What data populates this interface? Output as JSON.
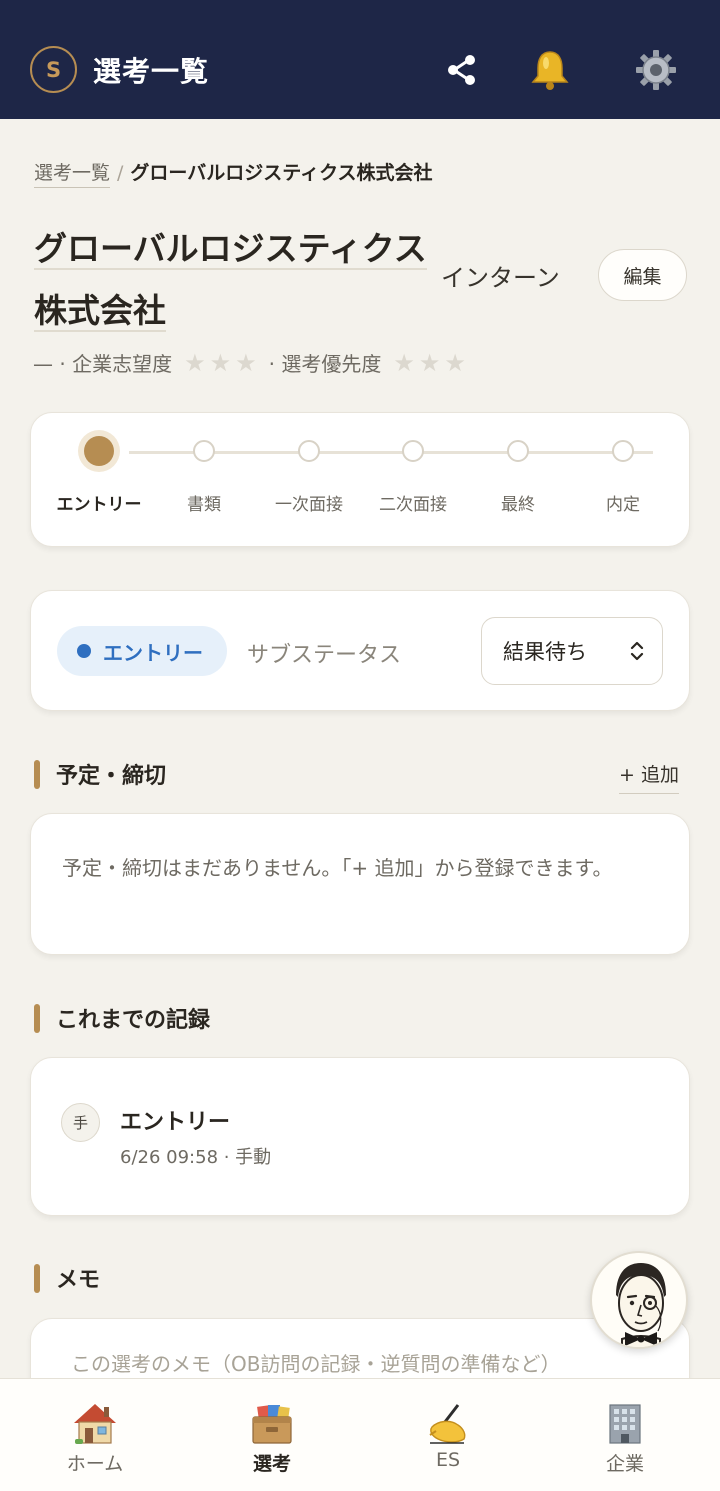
{
  "header": {
    "logo_letter": "S",
    "title": "選考一覧"
  },
  "breadcrumb": {
    "parent": "選考一覧",
    "separator": "/",
    "current": "グローバルロジスティクス株式会社"
  },
  "company": {
    "name": "グローバルロジスティクス株式会社",
    "job_type": "インターン",
    "edit_label": "編集"
  },
  "meta": {
    "prefix": "— · 企業志望度",
    "aspiration_stars": "★★★",
    "aspiration_rating": 0,
    "priority_label": "· 選考優先度",
    "priority_stars": "★★★",
    "priority_rating": 0
  },
  "stages": [
    {
      "label": "エントリー",
      "active": true
    },
    {
      "label": "書類",
      "active": false
    },
    {
      "label": "一次面接",
      "active": false
    },
    {
      "label": "二次面接",
      "active": false
    },
    {
      "label": "最終",
      "active": false
    },
    {
      "label": "内定",
      "active": false
    }
  ],
  "status": {
    "current": "エントリー",
    "substatus_label": "サブステータス",
    "substatus_value": "結果待ち"
  },
  "schedule": {
    "title": "予定・締切",
    "add_label": "+ 追加",
    "empty_text": "予定・締切はまだありません。「+ 追加」から登録できます。"
  },
  "history": {
    "title": "これまでの記録",
    "records": [
      {
        "icon_char": "手",
        "title": "エントリー",
        "sub": "6/26 09:58 · 手動"
      }
    ]
  },
  "memo": {
    "title": "メモ",
    "placeholder": "この選考のメモ（OB訪問の記録・逆質問の準備など）"
  },
  "tabs": [
    {
      "label": "ホーム",
      "icon": "house-icon",
      "active": false
    },
    {
      "label": "選考",
      "icon": "card-box-icon",
      "active": true
    },
    {
      "label": "ES",
      "icon": "writing-hand-icon",
      "active": false
    },
    {
      "label": "企業",
      "icon": "office-building-icon",
      "active": false
    }
  ],
  "colors": {
    "header_bg": "#1e2647",
    "accent": "#b68d52",
    "status_blue": "#2f6fc0",
    "background": "#f4f2ec"
  }
}
